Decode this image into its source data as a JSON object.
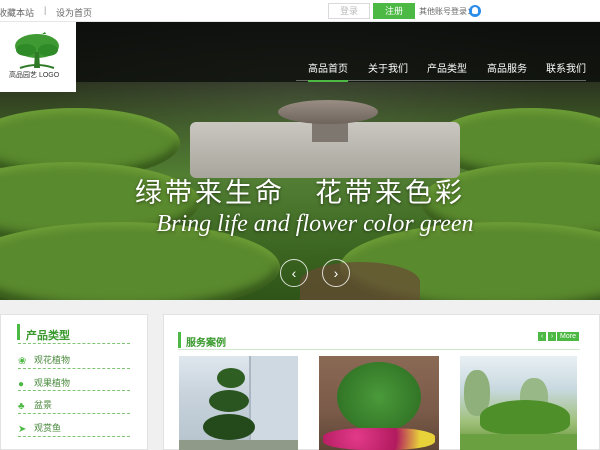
{
  "topbar": {
    "favorite": "收藏本站",
    "separator": "|",
    "set_home": "设为首页",
    "login": "登录",
    "register": "注册",
    "other_login": "其他账号登录："
  },
  "logo": {
    "text": "高品园艺 LOGO"
  },
  "nav": {
    "items": [
      "高品首页",
      "关于我们",
      "产品类型",
      "高品服务",
      "联系我们"
    ],
    "active_index": 0
  },
  "hero": {
    "slogan_cn": "绿带来生命　花带来色彩",
    "slogan_en": "Bring life and flower color green",
    "prev": "‹",
    "next": "›"
  },
  "categories": {
    "title": "产品类型",
    "items": [
      {
        "label": "观花植物",
        "icon": "flower-icon"
      },
      {
        "label": "观果植物",
        "icon": "fruit-icon"
      },
      {
        "label": "盆景",
        "icon": "bonsai-icon"
      },
      {
        "label": "观赏鱼",
        "icon": "fish-icon"
      }
    ]
  },
  "services": {
    "title": "服务案例",
    "prev": "‹",
    "next": "›",
    "more": "More"
  },
  "colors": {
    "accent": "#4cb944",
    "accent_text": "#3a9a2e",
    "qq": "#2a8de9"
  }
}
